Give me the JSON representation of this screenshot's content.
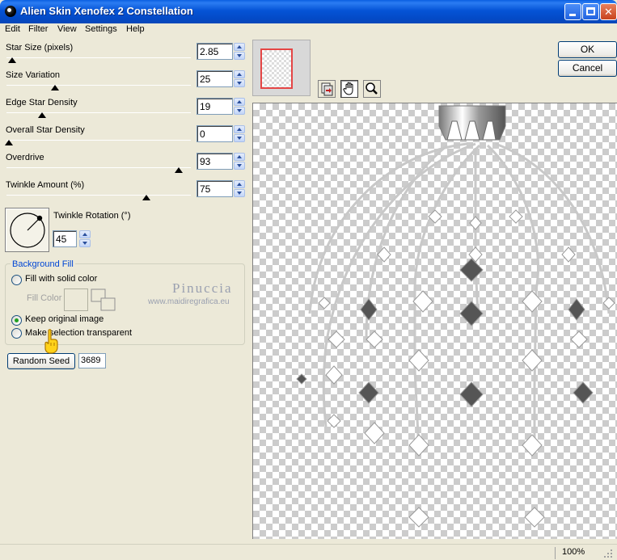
{
  "window": {
    "title": "Alien Skin Xenofex 2 Constellation"
  },
  "menu": [
    "Edit",
    "Filter",
    "View",
    "Settings",
    "Help"
  ],
  "sliders": [
    {
      "label": "Star Size (pixels)",
      "value": "2.85",
      "position": 0.03
    },
    {
      "label": "Size Variation",
      "value": "25",
      "position": 0.26
    },
    {
      "label": "Edge Star Density",
      "value": "19",
      "position": 0.19
    },
    {
      "label": "Overall Star Density",
      "value": "0",
      "position": 0.0
    },
    {
      "label": "Overdrive",
      "value": "93",
      "position": 0.93
    },
    {
      "label": "Twinkle Amount (%)",
      "value": "75",
      "position": 0.75
    }
  ],
  "rotation": {
    "label": "Twinkle Rotation (°)",
    "value": "45"
  },
  "background_fill": {
    "title": "Background Fill",
    "options": [
      {
        "label": "Fill with solid color",
        "checked": false
      },
      {
        "label": "Keep original image",
        "checked": true
      },
      {
        "label": "Make selection transparent",
        "checked": false
      }
    ],
    "fill_color_label": "Fill Color"
  },
  "random_seed": {
    "label": "Random Seed",
    "value": "3689"
  },
  "watermark": {
    "name": "Pinuccia",
    "url": "www.maidiregrafica.eu"
  },
  "buttons": {
    "ok": "OK",
    "cancel": "Cancel"
  },
  "status": {
    "zoom": "100%"
  }
}
